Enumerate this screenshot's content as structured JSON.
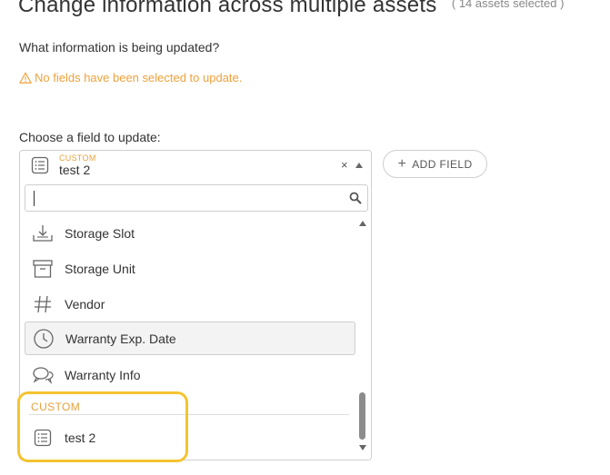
{
  "header": {
    "title": "Change information across multiple assets",
    "assets_count": "( 14 assets selected )"
  },
  "question": "What information is being updated?",
  "warning": "No fields have been selected to update.",
  "field_picker": {
    "label": "Choose a field to update:",
    "selected_group": "CUSTOM",
    "selected_value": "test 2",
    "clear_symbol": "×",
    "search_placeholder": "",
    "options": [
      {
        "label": "Storage Slot",
        "icon": "download-tray-icon"
      },
      {
        "label": "Storage Unit",
        "icon": "archive-box-icon"
      },
      {
        "label": "Vendor",
        "icon": "hash-icon"
      },
      {
        "label": "Warranty Exp. Date",
        "icon": "clock-icon",
        "highlighted": true
      },
      {
        "label": "Warranty Info",
        "icon": "chat-bubbles-icon"
      }
    ],
    "custom_group_label": "CUSTOM",
    "custom_options": [
      {
        "label": "test 2",
        "icon": "list-icon"
      }
    ]
  },
  "add_field_button": {
    "label": "ADD FIELD"
  },
  "colors": {
    "accent_orange": "#e6a23c",
    "warning_orange": "#f0a13a",
    "highlight_yellow": "#f4c430",
    "border": "#cfcfcf"
  }
}
